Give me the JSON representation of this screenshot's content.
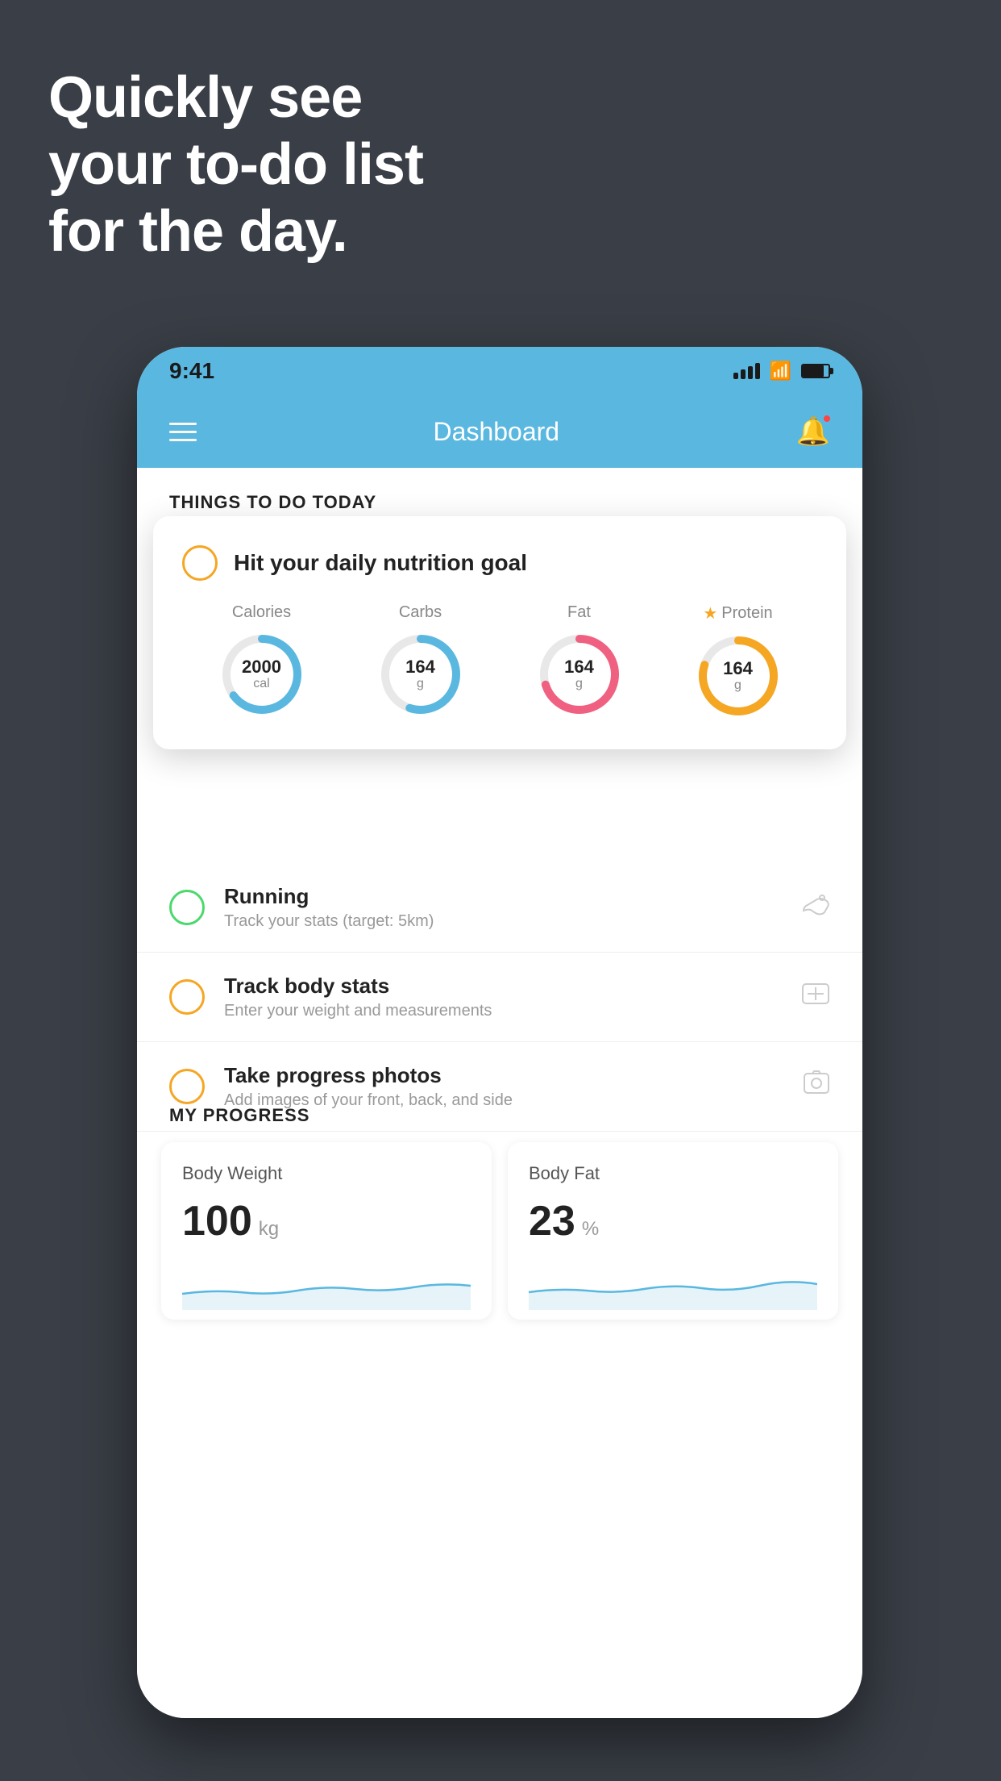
{
  "headline": {
    "line1": "Quickly see",
    "line2": "your to-do list",
    "line3": "for the day."
  },
  "status_bar": {
    "time": "9:41"
  },
  "app_header": {
    "title": "Dashboard"
  },
  "things_to_do_section": {
    "title": "THINGS TO DO TODAY"
  },
  "nutrition_card": {
    "title": "Hit your daily nutrition goal",
    "calories": {
      "label": "Calories",
      "value": "2000",
      "unit": "cal",
      "color": "#5ab8e0",
      "percent": 65
    },
    "carbs": {
      "label": "Carbs",
      "value": "164",
      "unit": "g",
      "color": "#5ab8e0",
      "percent": 55
    },
    "fat": {
      "label": "Fat",
      "value": "164",
      "unit": "g",
      "color": "#f06080",
      "percent": 70
    },
    "protein": {
      "label": "Protein",
      "value": "164",
      "unit": "g",
      "color": "#f5a623",
      "percent": 80
    }
  },
  "todo_items": [
    {
      "title": "Running",
      "subtitle": "Track your stats (target: 5km)",
      "circle_color": "green",
      "icon": "👟"
    },
    {
      "title": "Track body stats",
      "subtitle": "Enter your weight and measurements",
      "circle_color": "yellow",
      "icon": "⚖️"
    },
    {
      "title": "Take progress photos",
      "subtitle": "Add images of your front, back, and side",
      "circle_color": "yellow",
      "icon": "🖼️"
    }
  ],
  "my_progress": {
    "title": "MY PROGRESS",
    "body_weight": {
      "label": "Body Weight",
      "value": "100",
      "unit": "kg"
    },
    "body_fat": {
      "label": "Body Fat",
      "value": "23",
      "unit": "%"
    }
  }
}
